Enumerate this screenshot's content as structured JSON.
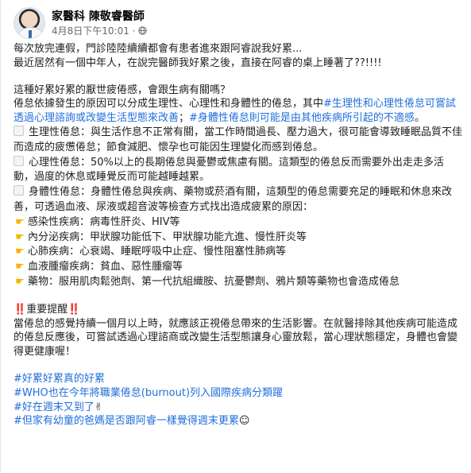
{
  "header": {
    "author": "家醫科 陳敬睿醫師",
    "timestamp": "4月8日下午10:01 · "
  },
  "icons": {
    "privacy": "globe-icon",
    "bullet": "square-icon",
    "pointing": "backhand-index-pointing-right-icon",
    "warning": "double-exclamation-icon",
    "victory": "victory-hand-icon",
    "laugh": "rolling-on-floor-laughing-icon"
  },
  "colors": {
    "hashtag": "#216fdb",
    "warning": "#e0245e",
    "text": "#1c1e21",
    "muted": "#65676b"
  },
  "post": {
    "intro": [
      "每次放完連假，門診陸陸續續都會有患者進來跟阿睿說我好累...",
      "最近居然有一個中年人，在說完醫師我好累之後，直接在阿睿的桌上睡著了??!!!!"
    ],
    "question": "這種好累好累的厭世疲倦感，會跟生病有關嗎？",
    "classification": {
      "text": "倦怠依據發生的原因可以分成生理性、心理性和身體性的倦怠，其中",
      "tag1": "#生理性和心理性倦怠可嘗試透過心理諮詢或改變生活型態來改善",
      "sep": "；",
      "tag2": "#身體性倦怠則可能是由其他疾病所引起的不適感",
      "end": "。"
    },
    "types": [
      "生理性倦怠：與生活作息不正常有關，當工作時間過長、壓力過大，很可能會導致睡眠品質不佳而造成的疲憊倦怠；節食減肥、懷孕也可能因生理變化而感到倦怠。",
      "心理性倦怠：50%以上的長期倦怠與憂鬱或焦慮有關。這類型的倦怠反而需要外出走走多活動，過度的休息或睡覺反而可能越睡越累。",
      "身體性倦怠：身體性倦怠與疾病、藥物或菸酒有關，這類型的倦怠需要充足的睡眠和休息來改善，可透過血液、尿液或超音波等檢查方式找出造成疲累的原因："
    ],
    "causes": [
      "感染性疾病：病毒性肝炎、HIV等",
      "內分泌疾病：甲狀腺功能低下、甲狀腺功能亢進、慢性肝炎等",
      "心肺疾病：心衰竭、睡眠呼吸中止症、慢性阻塞性肺病等",
      "血液腫瘤疾病：貧血、惡性腫瘤等",
      "藥物：服用肌肉鬆弛劑、第一代抗組織胺、抗憂鬱劑、鴉片類等藥物也會造成倦怠"
    ],
    "reminder_title": "重要提醒",
    "reminder_mark": "‼️",
    "reminder": "當倦怠的感覺持續一個月以上時，就應該正視倦怠帶來的生活影響。在就醫排除其他疾病可能造成的倦怠反應後，可嘗試透過心理諮商或改變生活型態讓身心靈放鬆，當心理狀態穩定，身體也會變得更健康喔！",
    "hashtags": [
      "#好累好累真的好累",
      "#WHO也在今年將職業倦怠(burnout)列入國際疾病分類躍",
      "#好在週末又到了",
      "#但家有幼童的爸媽是否跟阿睿一樣覺得週末更累"
    ]
  }
}
